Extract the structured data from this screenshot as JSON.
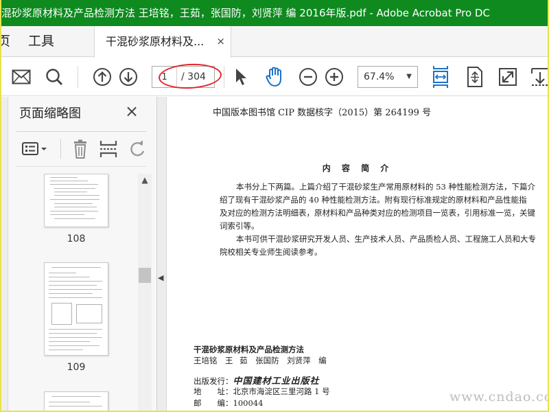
{
  "window": {
    "title": "混砂浆原材料及产品检测方法 王培铭，王茹，张国防，刘贤萍 编 2016年版.pdf - Adobe Acrobat Pro DC"
  },
  "menu": {
    "home_partial": "页",
    "tools": "工具"
  },
  "tab": {
    "label": "干混砂浆原材料及...",
    "close": "×"
  },
  "toolbar": {
    "page_current": "1",
    "page_total": "/ 304",
    "zoom": "67.4%",
    "zoom_caret": "▼"
  },
  "panel": {
    "title": "页面缩略图",
    "close": "×",
    "thumbnails": [
      {
        "label": "108"
      },
      {
        "label": "109"
      }
    ]
  },
  "document": {
    "cip": "中国版本图书馆 CIP 数据核字（2015）第 264199 号",
    "heading": "内 容 简 介",
    "summary_lines": [
      "本书分上下两篇。上篇介绍了干混砂浆生产常用原材料的 53 种性能检测方法，下篇介",
      "绍了现有干混砂浆产品的 40 种性能检测方法。附有现行标准规定的原材料和产品性能指",
      "及对应的检测方法明细表，原材料和产品种类对应的检测项目一览表，引用标准一览，关键",
      "词索引等。",
      "本书可供干混砂浆研究开发人员、生产技术人员、产品质检人员、工程施工人员和大专",
      "院校相关专业师生阅读参考。"
    ],
    "book_title": "干混砂浆原材料及产品检测方法",
    "authors": "王培铭　王 茹　张国防　刘贤萍　编",
    "publisher_label": "出版发行：",
    "publisher_name": "中国建材工业出版社",
    "address_label": "地　　址：",
    "address": "北京市海淀区三里河路 1 号",
    "postcode_label": "邮　　编：",
    "postcode": "100044"
  },
  "watermark": "www.cndao.com",
  "colors": {
    "titlebar": "#0e8a1f",
    "accent_blue": "#1a73c8",
    "annotation_red": "#e0262a"
  },
  "icons": [
    "mail-icon",
    "search-icon",
    "page-up-icon",
    "page-down-icon",
    "pointer-icon",
    "hand-icon",
    "zoom-out-icon",
    "zoom-in-icon",
    "fit-width-icon",
    "fit-page-icon",
    "full-screen-icon",
    "more-tools-icon",
    "thumbnail-options-icon",
    "delete-icon",
    "insert-page-icon",
    "rotate-icon"
  ]
}
